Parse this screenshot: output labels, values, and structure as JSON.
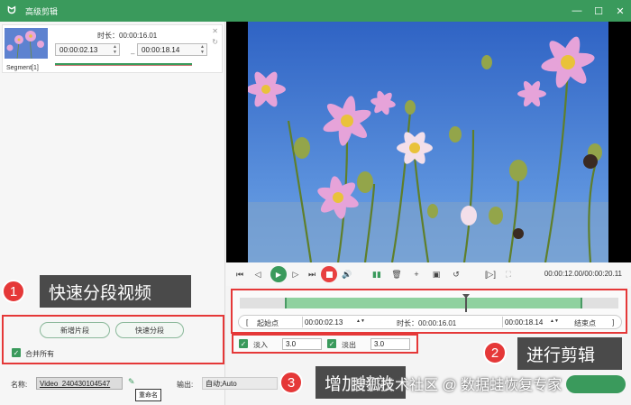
{
  "app": {
    "title": "高级剪辑",
    "logo": "ᗢ"
  },
  "window": {
    "minimize": "—",
    "maximize": "☐",
    "close": "✕"
  },
  "segment": {
    "label": "Segment[1]",
    "duration_label": "时长：00:00:16.01",
    "start": "00:00:02.13",
    "end": "00:00:18.14",
    "dash": "–"
  },
  "left_buttons": {
    "new_segment": "新增片段",
    "quick_split": "快速分段"
  },
  "merge_all": "合并所有",
  "player": {
    "time": "00:00:12.00/00:00:20.11"
  },
  "timeline": {
    "start_label": "起始点",
    "start_value": "00:00:02.13",
    "duration_label": "时长：00:00:16.01",
    "end_value": "00:00:18.14",
    "end_label": "结束点"
  },
  "effects": {
    "fade_in_label": "淡入",
    "fade_in_value": "3.0",
    "fade_out_label": "淡出",
    "fade_out_value": "3.0"
  },
  "bottom": {
    "name_label": "名称:",
    "name_value": "Video_240430104547",
    "rename_tooltip": "重命名",
    "output_label": "输出:",
    "output_value": "自动;Auto"
  },
  "annotations": {
    "one": {
      "num": "1",
      "text": "快速分段视频"
    },
    "two": {
      "num": "2",
      "text": "进行剪辑"
    },
    "three": {
      "num": "3",
      "text": "增加特效"
    }
  },
  "watermark": "搜狐技术社区 @ 数据蛙恢复专家",
  "colors": {
    "accent": "#3a9a5c",
    "annotation": "#e53838"
  }
}
